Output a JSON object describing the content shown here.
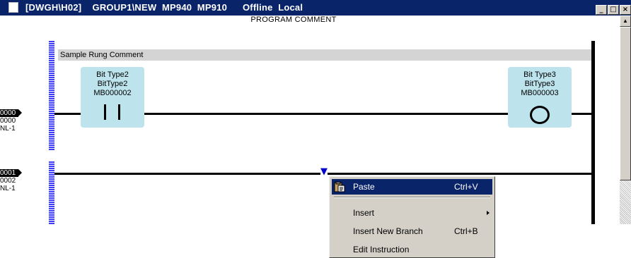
{
  "window": {
    "title_path": "[DWGH\\H02]    GROUP1\\NEW  MP940  MP910",
    "title_status": "Offline  Local",
    "buttons": [
      "minimize",
      "maximize",
      "close"
    ]
  },
  "header": {
    "program_comment": "PROGRAM COMMENT"
  },
  "rungs": [
    {
      "number": "0000",
      "step": "0000",
      "nest": "NL-1",
      "comment": "Sample Rung Comment",
      "elements": [
        {
          "kind": "contact",
          "lines": [
            "Bit Type2",
            "BitType2",
            "MB000002"
          ]
        },
        {
          "kind": "coil",
          "lines": [
            "Bit Type3",
            "BitType3",
            "MB000003"
          ]
        }
      ]
    },
    {
      "number": "0001",
      "step": "0002",
      "nest": "NL-1"
    }
  ],
  "cursor": {
    "glyph": " "
  },
  "context_menu": {
    "items": [
      {
        "label": "Paste",
        "accel": "Ctrl+V",
        "icon": "paste-icon",
        "selected": true
      },
      {
        "label": "Insert",
        "accel": "",
        "submenu": true
      },
      {
        "label": "Insert New Branch",
        "accel": "Ctrl+B"
      },
      {
        "label": "Edit Instruction",
        "accel": ""
      }
    ]
  },
  "colors": {
    "titlebar": "#0a246a",
    "rail": "#3c3cff",
    "element_bg": "#bde3ec",
    "menu_bg": "#d4d0c8",
    "selection": "#0a246a"
  }
}
